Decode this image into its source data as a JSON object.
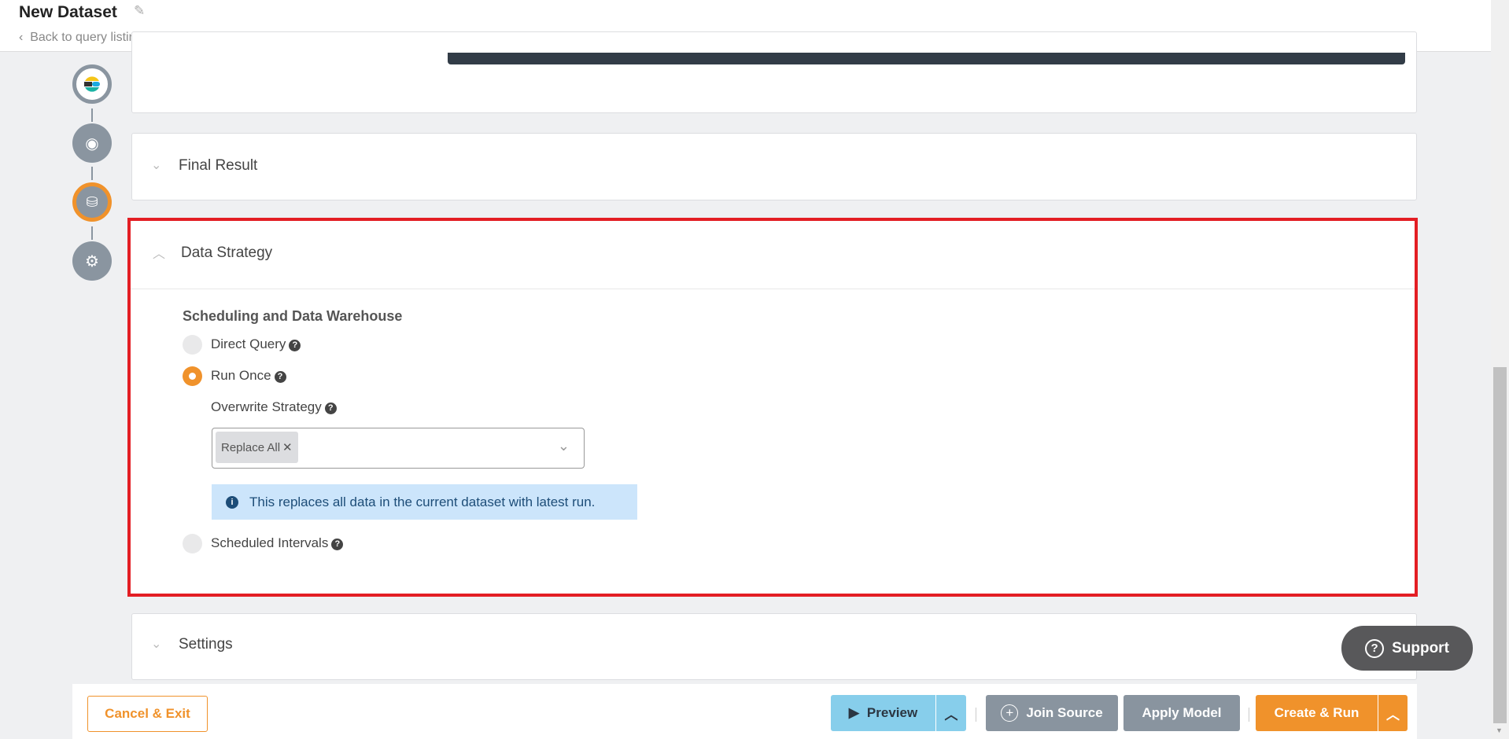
{
  "header": {
    "title": "New Dataset",
    "back_link": "Back to query listing"
  },
  "steps": [
    {
      "icon": "elastic-logo-icon"
    },
    {
      "icon": "eye-icon"
    },
    {
      "icon": "database-settings-icon",
      "active": true
    },
    {
      "icon": "gear-icon"
    }
  ],
  "final_result": {
    "title": "Final Result"
  },
  "data_strategy": {
    "title": "Data Strategy",
    "section_heading": "Scheduling and Data Warehouse",
    "options": [
      {
        "label": "Direct Query",
        "selected": false
      },
      {
        "label": "Run Once",
        "selected": true
      },
      {
        "label": "Scheduled Intervals",
        "selected": false
      }
    ],
    "overwrite_label": "Overwrite Strategy",
    "overwrite_value": "Replace All",
    "info_text": "This replaces all data in the current dataset with latest run."
  },
  "settings": {
    "title": "Settings"
  },
  "footer": {
    "cancel": "Cancel & Exit",
    "preview": "Preview",
    "join_source": "Join Source",
    "apply_model": "Apply Model",
    "create_run": "Create & Run"
  },
  "support": {
    "label": "Support"
  },
  "colors": {
    "accent": "#f0922b",
    "preview": "#87ceeb",
    "gray_button": "#89949f",
    "highlight": "#e31e24",
    "info_bg": "#cce5fb"
  }
}
